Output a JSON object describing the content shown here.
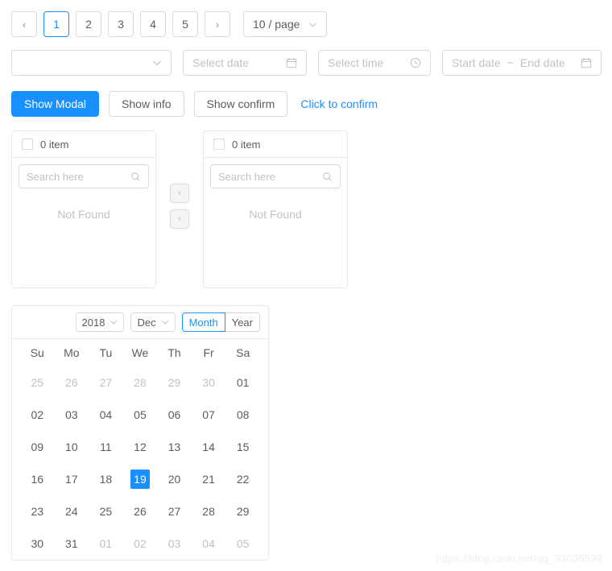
{
  "pagination": {
    "prev_label": "‹",
    "next_label": "›",
    "pages": [
      "1",
      "2",
      "3",
      "4",
      "5"
    ],
    "active_page": "1",
    "page_size_label": "10 / page",
    "caret_icon": "chevron-down-icon"
  },
  "form": {
    "select_value": "",
    "date_placeholder": "Select date",
    "time_placeholder": "Select time",
    "range_start_placeholder": "Start date",
    "range_separator": "~",
    "range_end_placeholder": "End date"
  },
  "buttons": {
    "show_modal": "Show Modal",
    "show_info": "Show info",
    "show_confirm": "Show confirm",
    "click_to_confirm": "Click to confirm"
  },
  "transfer": {
    "left": {
      "count_label": "0 item",
      "search_placeholder": "Search here",
      "empty_text": "Not Found"
    },
    "right": {
      "count_label": "0 item",
      "search_placeholder": "Search here",
      "empty_text": "Not Found"
    },
    "to_right_label": "›",
    "to_left_label": "‹"
  },
  "calendar": {
    "year": "2018",
    "month": "Dec",
    "mode_month": "Month",
    "mode_year": "Year",
    "active_mode": "Month",
    "weekdays": [
      "Su",
      "Mo",
      "Tu",
      "We",
      "Th",
      "Fr",
      "Sa"
    ],
    "selected_day": "19",
    "weeks": [
      [
        {
          "d": "25",
          "dim": true
        },
        {
          "d": "26",
          "dim": true
        },
        {
          "d": "27",
          "dim": true
        },
        {
          "d": "28",
          "dim": true
        },
        {
          "d": "29",
          "dim": true
        },
        {
          "d": "30",
          "dim": true
        },
        {
          "d": "01",
          "dim": false
        }
      ],
      [
        {
          "d": "02",
          "dim": false
        },
        {
          "d": "03",
          "dim": false
        },
        {
          "d": "04",
          "dim": false
        },
        {
          "d": "05",
          "dim": false
        },
        {
          "d": "06",
          "dim": false
        },
        {
          "d": "07",
          "dim": false
        },
        {
          "d": "08",
          "dim": false
        }
      ],
      [
        {
          "d": "09",
          "dim": false
        },
        {
          "d": "10",
          "dim": false
        },
        {
          "d": "11",
          "dim": false
        },
        {
          "d": "12",
          "dim": false
        },
        {
          "d": "13",
          "dim": false
        },
        {
          "d": "14",
          "dim": false
        },
        {
          "d": "15",
          "dim": false
        }
      ],
      [
        {
          "d": "16",
          "dim": false
        },
        {
          "d": "17",
          "dim": false
        },
        {
          "d": "18",
          "dim": false
        },
        {
          "d": "19",
          "dim": false,
          "selected": true
        },
        {
          "d": "20",
          "dim": false
        },
        {
          "d": "21",
          "dim": false
        },
        {
          "d": "22",
          "dim": false
        }
      ],
      [
        {
          "d": "23",
          "dim": false
        },
        {
          "d": "24",
          "dim": false
        },
        {
          "d": "25",
          "dim": false
        },
        {
          "d": "26",
          "dim": false
        },
        {
          "d": "27",
          "dim": false
        },
        {
          "d": "28",
          "dim": false
        },
        {
          "d": "29",
          "dim": false
        }
      ],
      [
        {
          "d": "30",
          "dim": false
        },
        {
          "d": "31",
          "dim": false
        },
        {
          "d": "01",
          "dim": true
        },
        {
          "d": "02",
          "dim": true
        },
        {
          "d": "03",
          "dim": true
        },
        {
          "d": "04",
          "dim": true
        },
        {
          "d": "05",
          "dim": true
        }
      ]
    ]
  },
  "watermark": {
    "text": "https://blog.csdn.net/qq_33036599"
  },
  "colors": {
    "primary": "#1890ff",
    "border": "#d9d9d9",
    "panel_border": "#e8e8e8",
    "text": "rgba(0,0,0,.65)",
    "placeholder": "rgba(0,0,0,.25)"
  }
}
